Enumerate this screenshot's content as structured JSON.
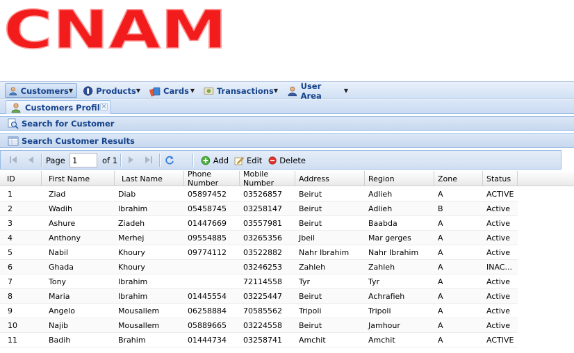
{
  "logo": {
    "text": "CNAM",
    "color": "#f21c1c"
  },
  "menubar": {
    "items": [
      {
        "label": "Customers",
        "icon": "customer-icon"
      },
      {
        "label": "Products",
        "icon": "product-icon"
      },
      {
        "label": "Cards",
        "icon": "cards-icon"
      },
      {
        "label": "Transactions",
        "icon": "transactions-icon"
      },
      {
        "label": "User Area",
        "icon": "user-icon"
      }
    ]
  },
  "tabs": [
    {
      "label": "Customers Profile",
      "icon": "customer-icon"
    }
  ],
  "panels": {
    "search": {
      "title": "Search for Customer",
      "icon": "search-icon"
    },
    "results": {
      "title": "Search Customer Results",
      "icon": "table-icon"
    }
  },
  "toolbar": {
    "page_label": "Page",
    "page_value": "1",
    "of_label": "of 1",
    "add_label": "Add",
    "edit_label": "Edit",
    "delete_label": "Delete"
  },
  "grid": {
    "columns": [
      "ID",
      "First Name",
      "Last Name",
      "Phone Number",
      "Mobile Number",
      "Address",
      "Region",
      "Zone",
      "Status"
    ],
    "rows": [
      [
        "1",
        "Ziad",
        "Diab",
        "05897452",
        "03526857",
        "Beirut",
        "Adlieh",
        "A",
        "ACTIVE"
      ],
      [
        "2",
        "Wadih",
        "Ibrahim",
        "05458745",
        "03258147",
        "Beirut",
        "Adlieh",
        "B",
        "Active"
      ],
      [
        "3",
        "Ashure",
        "Ziadeh",
        "01447669",
        "03557981",
        "Beirut",
        "Baabda",
        "A",
        "Active"
      ],
      [
        "4",
        "Anthony",
        "Merhej",
        "09554885",
        "03265356",
        "Jbeil",
        "Mar gerges",
        "A",
        "Active"
      ],
      [
        "5",
        "Nabil",
        "Khoury",
        "09774112",
        "03522882",
        "Nahr Ibrahim",
        "Nahr Ibrahim",
        "A",
        "Active"
      ],
      [
        "6",
        "Ghada",
        "Khoury",
        "",
        "03246253",
        "Zahleh",
        "Zahleh",
        "A",
        "INAC..."
      ],
      [
        "7",
        "Tony",
        "Ibrahim",
        "",
        "72114558",
        "Tyr",
        "Tyr",
        "A",
        "Active"
      ],
      [
        "8",
        "Maria",
        "Ibrahim",
        "01445554",
        "03225447",
        "Beirut",
        "Achrafieh",
        "A",
        "Active"
      ],
      [
        "9",
        "Angelo",
        "Mousallem",
        "06258884",
        "70585562",
        "Tripoli",
        "Tripoli",
        "A",
        "Active"
      ],
      [
        "10",
        "Najib",
        "Mousallem",
        "05889665",
        "03224558",
        "Beirut",
        "Jamhour",
        "A",
        "Active"
      ],
      [
        "11",
        "Badih",
        "Brahim",
        "01444734",
        "03258741",
        "Amchit",
        "Amchit",
        "A",
        "ACTIVE"
      ]
    ]
  }
}
